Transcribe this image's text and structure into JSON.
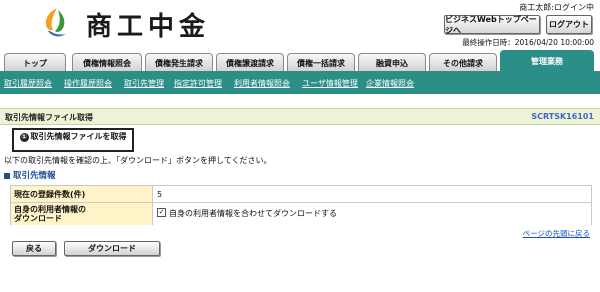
{
  "header": {
    "logo_text": "商工中金",
    "user_name": "商工太郎:ログイン中",
    "biz_button": "ビジネスWebトップページへ",
    "logout_button": "ログアウト",
    "last_operation": "最終操作日時：2016/04/20 10:00:00"
  },
  "tabs": [
    {
      "label": "トップ",
      "active": false
    },
    {
      "label": "債権情報照会",
      "active": false
    },
    {
      "label": "債権発生請求",
      "active": false
    },
    {
      "label": "債権譲渡請求",
      "active": false
    },
    {
      "label": "債権一括請求",
      "active": false
    },
    {
      "label": "融資申込",
      "active": false
    },
    {
      "label": "その他請求",
      "active": false
    },
    {
      "label": "管理業務",
      "active": true
    }
  ],
  "submenu": [
    "取引履歴照会",
    "操作履歴照会",
    "取引先管理",
    "指定許可管理",
    "利用者情報照会",
    "ユーザ情報管理",
    "企業情報照会"
  ],
  "page": {
    "title": "取引先情報ファイル取得",
    "screen_id": "SCRTSK16101",
    "step_number": "①",
    "step_label": "取引先情報ファイルを取得",
    "instruction": "以下の取引先情報を確認の上、「ダウンロード」ボタンを押してください。",
    "section_title": "取引先情報",
    "rows": [
      {
        "label": "現在の登録件数(件)",
        "value": "5"
      },
      {
        "label": "自身の利用者情報の\nダウンロード",
        "value": "自身の利用者情報を合わせてダウンロードする",
        "checked": true
      }
    ],
    "page_top_link": "ページの先頭に戻る",
    "back_button": "戻る",
    "download_button": "ダウンロード"
  },
  "colors": {
    "accent": "#2b8f88",
    "title_bar": "#eef3d6",
    "label_cell": "#fff3c8",
    "section_title": "#1f4d96",
    "screen_id": "#3a69c7"
  }
}
